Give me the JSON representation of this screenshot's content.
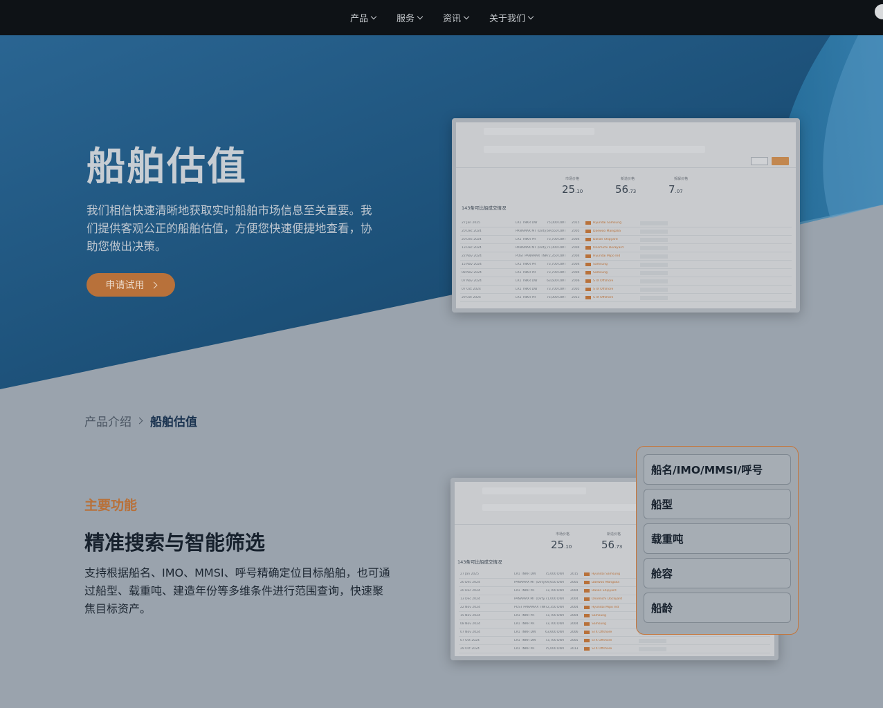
{
  "nav": {
    "items": [
      {
        "label": "产品"
      },
      {
        "label": "服务"
      },
      {
        "label": "资讯"
      },
      {
        "label": "关于我们"
      }
    ]
  },
  "hero": {
    "title": "船舶估值",
    "description": "我们相信快速清晰地获取实时船舶市场信息至关重要。我们提供客观公正的船舶估值，方便您快速便捷地查看，协助您做出决策。",
    "cta_label": "申请试用"
  },
  "preview": {
    "stats": [
      {
        "label": "市场价格",
        "value": "25",
        "decimal": ".10"
      },
      {
        "label": "新造价格",
        "value": "56",
        "decimal": ".73"
      },
      {
        "label": "拆解价格",
        "value": "7",
        "decimal": ".07"
      }
    ],
    "table_title": "143条可比船成交情况",
    "rows": [
      {
        "date": "27 Jan 2025",
        "type": "LR1 TNKR DW",
        "dwt": "75,000 DWT",
        "year": "2015",
        "yard": "Hyundai Samsung"
      },
      {
        "date": "20 Dec 2024",
        "type": "PANAMAX MT (Dirty)",
        "dwt": "69,650 DWT",
        "year": "2005",
        "yard": "Daewoo Mangalia"
      },
      {
        "date": "20 Dec 2024",
        "type": "LR1 TNKR PR",
        "dwt": "73,700 DWT",
        "year": "2004",
        "yard": "Dalian Shipyard"
      },
      {
        "date": "13 Dec 2024",
        "type": "PANAMAX MT (Dirty)",
        "dwt": "71,000 DWT",
        "year": "2004",
        "yard": "Onomichi Dockyard"
      },
      {
        "date": "22 Nov 2024",
        "type": "POST PANAMAX TNK",
        "dwt": "72,350 DWT",
        "year": "2004",
        "yard": "Hyundai Mipo Ind"
      },
      {
        "date": "15 Nov 2024",
        "type": "LR1 TNKR PR",
        "dwt": "73,700 DWT",
        "year": "2004",
        "yard": "Samsung"
      },
      {
        "date": "08 Nov 2024",
        "type": "LR1 TNKR PR",
        "dwt": "73,700 DWT",
        "year": "2004",
        "yard": "Samsung"
      },
      {
        "date": "07 Nov 2024",
        "type": "LR1 TNKR DW",
        "dwt": "63,600 DWT",
        "year": "2006",
        "yard": "STX Offshore"
      },
      {
        "date": "07 Oct 2024",
        "type": "LR1 TNKR DW",
        "dwt": "73,700 DWT",
        "year": "2005",
        "yard": "STX Offshore"
      },
      {
        "date": "29 Oct 2024",
        "type": "LR1 TNKR PR",
        "dwt": "75,000 DWT",
        "year": "2013",
        "yard": "STX Offshore"
      }
    ]
  },
  "breadcrumb": {
    "parent": "产品介绍",
    "current": "船舶估值"
  },
  "feature": {
    "tag": "主要功能",
    "title": "精准搜索与智能筛选",
    "description": "支持根据船名、IMO、MMSI、呼号精确定位目标船舶，也可通过船型、载重吨、建造年份等多维条件进行范围查询，快速聚焦目标资产。",
    "filters": [
      {
        "label": "船名/IMO/MMSI/呼号"
      },
      {
        "label": "船型"
      },
      {
        "label": "载重吨"
      },
      {
        "label": "舱容"
      },
      {
        "label": "船龄"
      }
    ]
  },
  "colors": {
    "nav_bg": "#0e1216",
    "hero_blue": "#1d5680",
    "accent_orange": "#b8713a",
    "page_bg": "#9aa3ad"
  }
}
